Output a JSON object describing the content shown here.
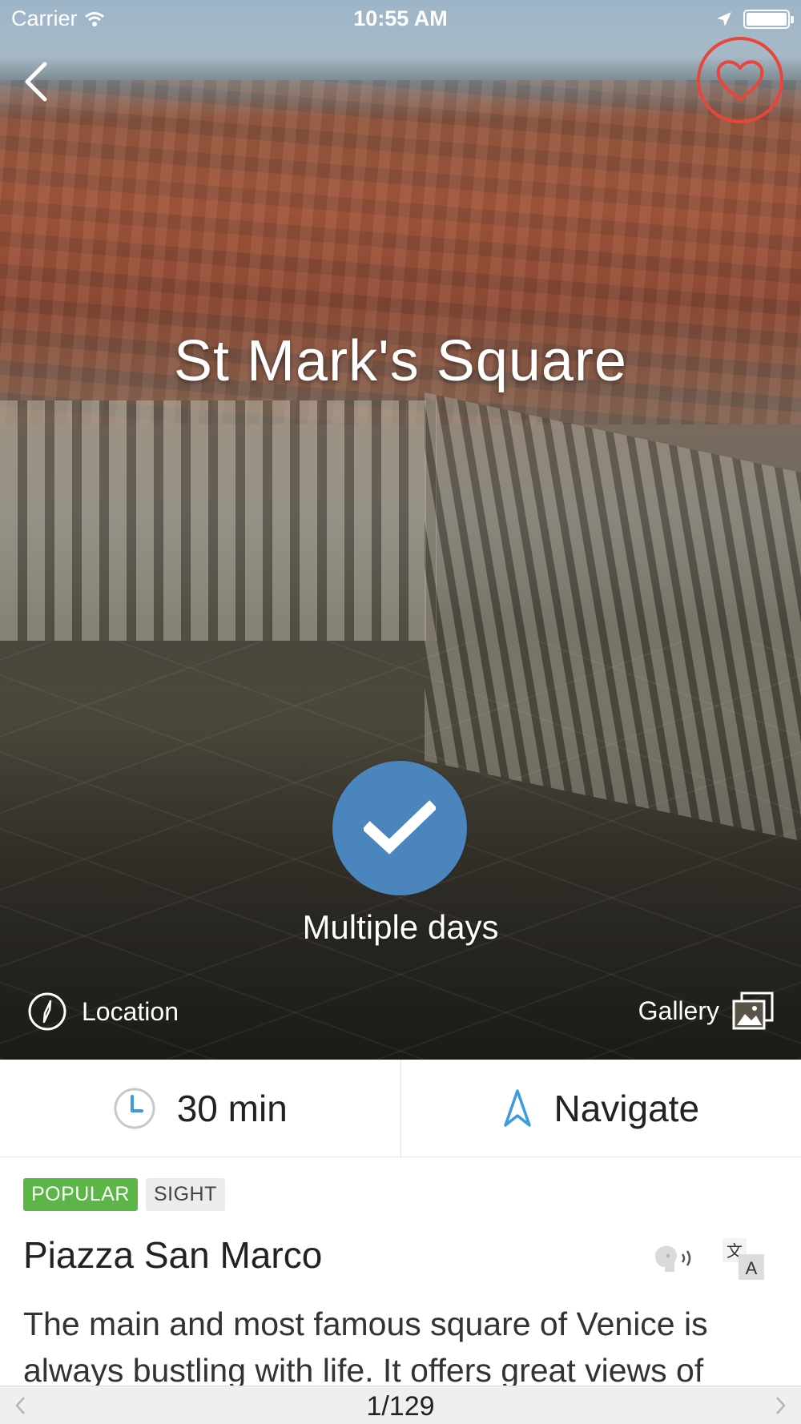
{
  "status_bar": {
    "carrier": "Carrier",
    "time": "10:55 AM"
  },
  "hero": {
    "title": "St Mark's Square",
    "check_label": "Multiple days",
    "location_label": "Location",
    "gallery_label": "Gallery"
  },
  "info": {
    "duration_value": "30",
    "duration_unit": "min",
    "navigate_label": "Navigate"
  },
  "tags": [
    "POPULAR",
    "SIGHT"
  ],
  "place": {
    "name": "Piazza San Marco",
    "description": "The main and most famous square of Venice is always bustling with life. It offers great views of"
  },
  "pager": {
    "count": "1/129"
  },
  "colors": {
    "favorite": "#e8463c",
    "check_button": "#4a86bd",
    "tag_popular": "#5cb547",
    "accent_blue": "#3a9be0"
  },
  "icons": {
    "wifi": "wifi-icon",
    "location_arrow": "location-arrow-icon",
    "battery": "battery-icon",
    "back": "chevron-left-icon",
    "favorite": "heart-icon",
    "check": "checkmark-icon",
    "compass": "compass-icon",
    "gallery": "gallery-icon",
    "clock": "clock-icon",
    "navigate": "navigate-arrow-icon",
    "speak": "speak-icon",
    "translate": "translate-icon"
  }
}
